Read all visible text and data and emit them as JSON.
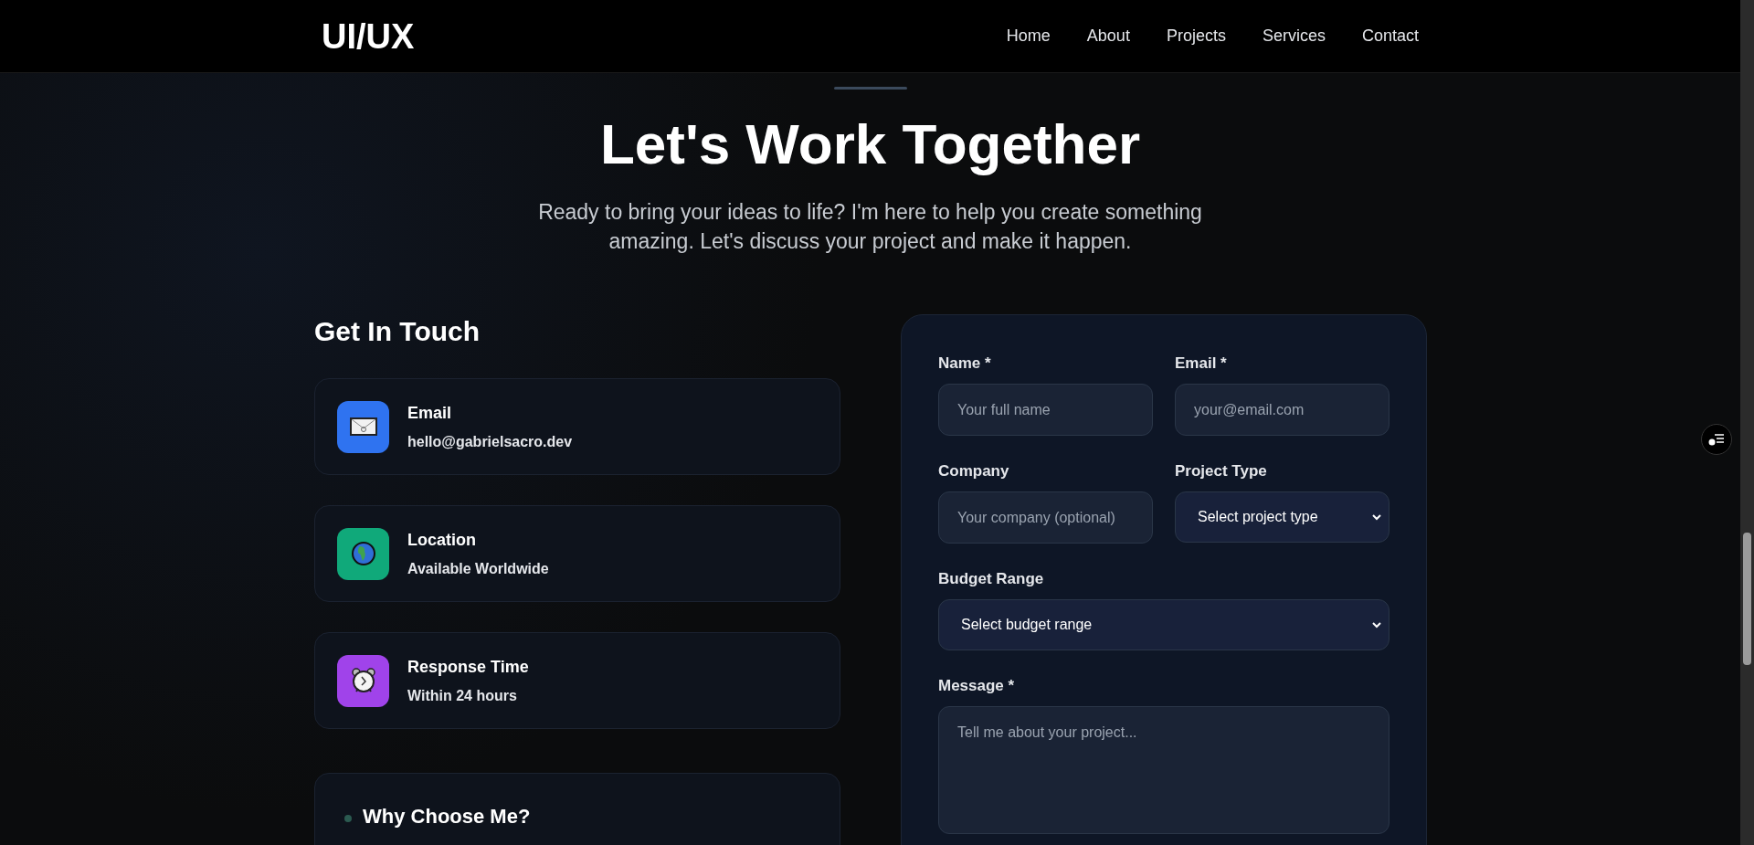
{
  "nav": {
    "logo": "UI/UX",
    "links": [
      {
        "label": "Home"
      },
      {
        "label": "About"
      },
      {
        "label": "Projects"
      },
      {
        "label": "Services"
      },
      {
        "label": "Contact"
      }
    ]
  },
  "hero": {
    "title": "Let's Work Together",
    "subtitle": "Ready to bring your ideas to life? I'm here to help you create something amazing. Let's discuss your project and make it happen."
  },
  "contact": {
    "heading": "Get In Touch",
    "items": [
      {
        "kind": "email",
        "title": "Email",
        "value": "hello@gabrielsacro.dev",
        "color": "#2f73f0"
      },
      {
        "kind": "location",
        "title": "Location",
        "value": "Available Worldwide",
        "color": "#10a97a"
      },
      {
        "kind": "time",
        "title": "Response Time",
        "value": "Within 24 hours",
        "color": "#a043ea"
      }
    ],
    "why_heading": "Why Choose Me?"
  },
  "form": {
    "rows": [
      [
        {
          "kind": "input",
          "label": "Name *",
          "placeholder": "Your full name"
        },
        {
          "kind": "input",
          "label": "Email *",
          "placeholder": "your@email.com"
        }
      ],
      [
        {
          "kind": "input",
          "label": "Company",
          "placeholder": "Your company (optional)"
        },
        {
          "kind": "select",
          "label": "Project Type",
          "value": "Select project type"
        }
      ],
      [
        {
          "kind": "select",
          "label": "Budget Range",
          "value": "Select budget range"
        }
      ],
      [
        {
          "kind": "textarea",
          "label": "Message *",
          "placeholder": "Tell me about your project..."
        }
      ]
    ]
  }
}
